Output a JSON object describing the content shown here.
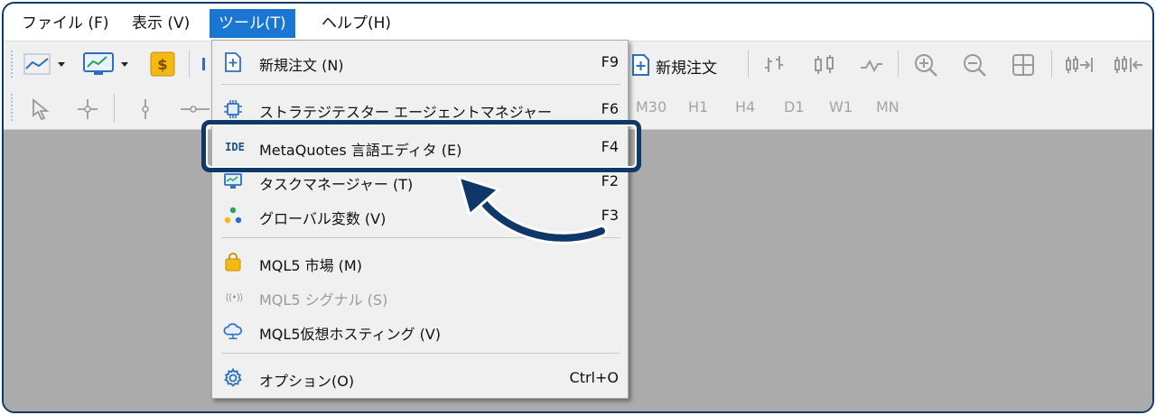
{
  "menubar": {
    "items": [
      {
        "label": "ファイル (F)"
      },
      {
        "label": "表示 (V)"
      },
      {
        "label": "ツール(T)"
      },
      {
        "label": "ヘルプ(H)"
      }
    ]
  },
  "toolbar": {
    "new_order_label": "新規注文",
    "timeframes": [
      "M30",
      "H1",
      "H4",
      "D1",
      "W1",
      "MN"
    ]
  },
  "tools_menu": {
    "items": [
      {
        "label": "新規注文 (N)",
        "shortcut": "F9",
        "icon": "new-order-icon"
      },
      {
        "label": "ストラテジテスター エージェントマネジャー",
        "shortcut": "F6",
        "icon": "chip-icon"
      },
      {
        "label": "MetaQuotes 言語エディタ (E)",
        "shortcut": "F4",
        "icon": "ide-icon",
        "icon_text": "IDE"
      },
      {
        "label": "タスクマネージャー (T)",
        "shortcut": "F2",
        "icon": "monitor-icon"
      },
      {
        "label": "グローバル変数 (V)",
        "shortcut": "F3",
        "icon": "global-variables-icon"
      },
      {
        "label": "MQL5 市場 (M)",
        "shortcut": "",
        "icon": "shopping-bag-icon"
      },
      {
        "label": "MQL5 シグナル (S)",
        "shortcut": "",
        "icon": "signal-icon",
        "icon_text": "((•))"
      },
      {
        "label": "MQL5仮想ホスティング (V)",
        "shortcut": "",
        "icon": "cloud-icon"
      },
      {
        "label": "オプション(O)",
        "shortcut": "Ctrl+O",
        "icon": "gear-icon"
      }
    ]
  },
  "colors": {
    "accent": "#1976d2",
    "highlight_border": "#0e3868",
    "workspace": "#ababab"
  }
}
